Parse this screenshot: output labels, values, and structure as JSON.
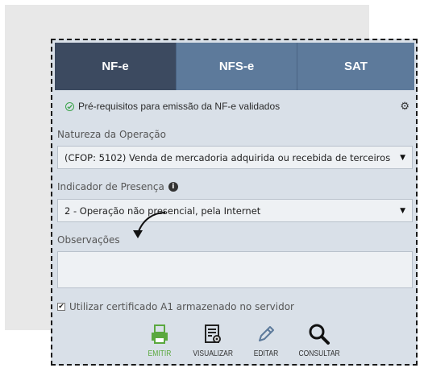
{
  "tabs": [
    {
      "label": "NF-e",
      "active": true
    },
    {
      "label": "NFS-e",
      "active": false
    },
    {
      "label": "SAT",
      "active": false
    }
  ],
  "status": {
    "text": "Pré-requisitos para emissão da NF-e validados",
    "icon": "check-circle-icon",
    "settings_icon": "gear-icon"
  },
  "natureza": {
    "label": "Natureza da Operação",
    "value": "(CFOP: 5102) Venda de mercadoria adquirida ou recebida de terceiros"
  },
  "presenca": {
    "label": "Indicador de Presença",
    "value": "2 - Operação não presencial, pela Internet"
  },
  "observacoes": {
    "label": "Observações",
    "value": ""
  },
  "certificado": {
    "label": "Utilizar certificado A1 armazenado no servidor",
    "checked": true
  },
  "actions": [
    {
      "label": "EMITIR",
      "icon": "printer-icon",
      "color": "#5aa83e"
    },
    {
      "label": "VISUALIZAR",
      "icon": "document-view-icon"
    },
    {
      "label": "EDITAR",
      "icon": "pencil-icon"
    },
    {
      "label": "CONSULTAR",
      "icon": "magnifier-icon"
    }
  ],
  "colors": {
    "tab_active": "#3c4a60",
    "tab_inactive": "#5d7a9b",
    "panel_bg": "#d9e0e8",
    "accent_green": "#5aa83e"
  }
}
